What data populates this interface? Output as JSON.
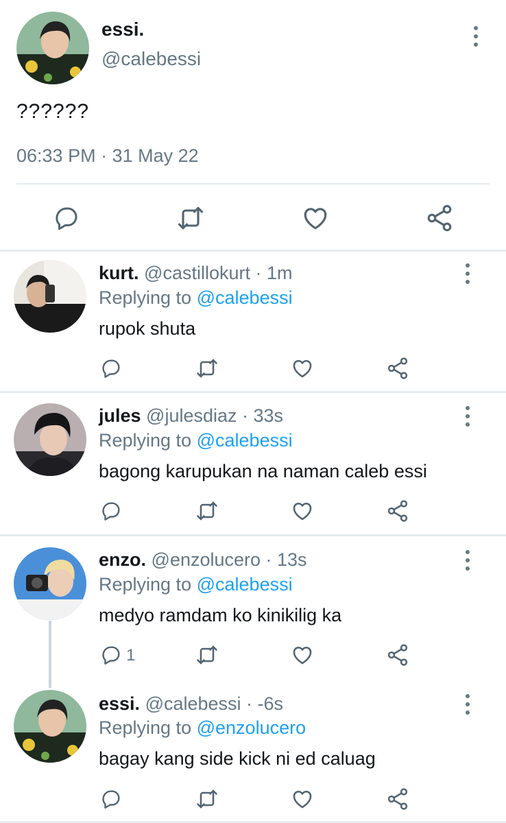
{
  "main_tweet": {
    "name": "essi.",
    "handle": "@calebessi",
    "text": "??????",
    "time": "06:33 PM",
    "date": "31 May 22",
    "meta": "06:33 PM · 31 May 22"
  },
  "replies": [
    {
      "name": "kurt.",
      "handle_time": "@castillokurt · 1m",
      "replying_label": "Replying to",
      "mention": "@calebessi",
      "text": "rupok shuta",
      "reply_count": ""
    },
    {
      "name": "jules",
      "handle_time": "@julesdiaz · 33s",
      "replying_label": "Replying to",
      "mention": "@calebessi",
      "text": "bagong karupukan na naman caleb essi",
      "reply_count": ""
    },
    {
      "name": "enzo.",
      "handle_time": "@enzolucero · 13s",
      "replying_label": "Replying to",
      "mention": "@calebessi",
      "text": "medyo ramdam ko kinikilig ka",
      "reply_count": "1"
    },
    {
      "name": "essi.",
      "handle_time": "@calebessi · -6s",
      "replying_label": "Replying to",
      "mention": "@enzolucero",
      "text": "bagay kang side kick ni ed caluag",
      "reply_count": ""
    }
  ],
  "colors": {
    "primary_text": "#14171a",
    "secondary_text": "#657786",
    "link": "#1da1f2",
    "divider": "#e6ecf0",
    "icon": "#536471"
  },
  "icons": [
    "reply-icon",
    "retweet-icon",
    "like-icon",
    "share-icon",
    "more-vertical-icon"
  ]
}
